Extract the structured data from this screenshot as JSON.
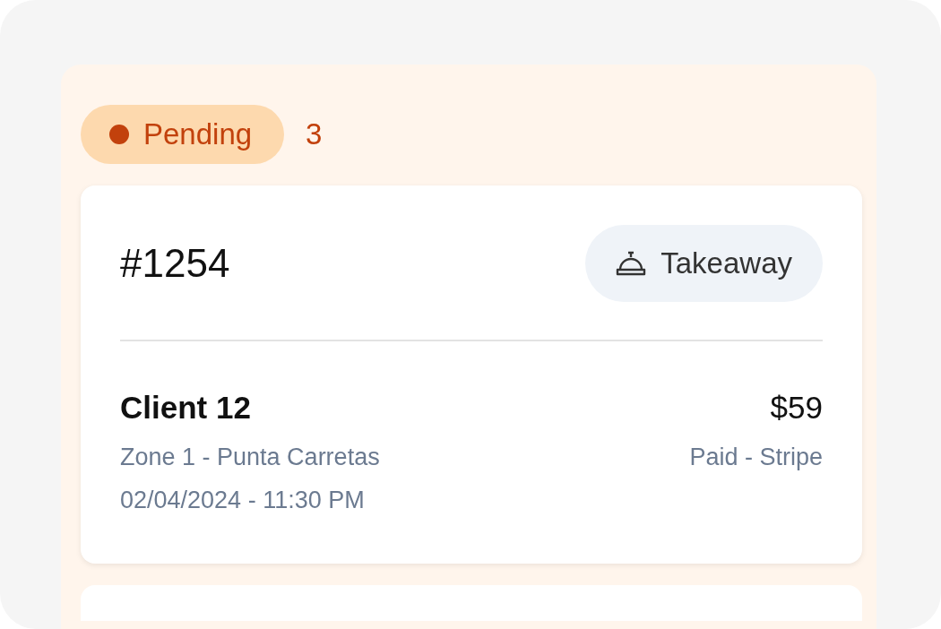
{
  "column": {
    "status": "Pending",
    "count": "3"
  },
  "orders": [
    {
      "number": "#1254",
      "type": "Takeaway",
      "client": "Client 12",
      "zone": "Zone 1 - Punta Carretas",
      "datetime": "02/04/2024 - 11:30 PM",
      "total": "$59",
      "payment": "Paid - Stripe"
    }
  ]
}
